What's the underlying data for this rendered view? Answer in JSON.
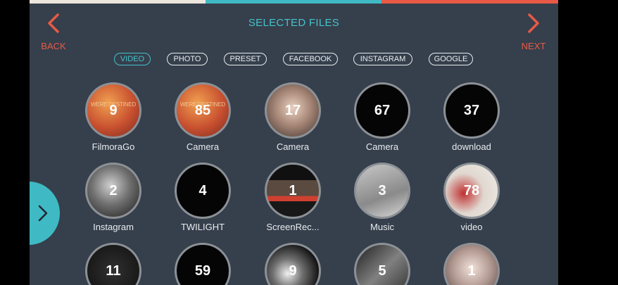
{
  "header": {
    "title": "SELECTED FILES",
    "back_label": "BACK",
    "next_label": "NEXT"
  },
  "filters": [
    {
      "label": "VIDEO",
      "active": true
    },
    {
      "label": "PHOTO",
      "active": false
    },
    {
      "label": "PRESET",
      "active": false
    },
    {
      "label": "FACEBOOK",
      "active": false
    },
    {
      "label": "INSTAGRAM",
      "active": false
    },
    {
      "label": "GOOGLE",
      "active": false
    }
  ],
  "folders": [
    {
      "name": "FilmoraGo",
      "count": "9",
      "overlay": "WERE DESTINED LY"
    },
    {
      "name": "Camera",
      "count": "85",
      "overlay": "WERE DESTINED LY"
    },
    {
      "name": "Camera",
      "count": "17"
    },
    {
      "name": "Camera",
      "count": "67"
    },
    {
      "name": "download",
      "count": "37"
    },
    {
      "name": "Instagram",
      "count": "2"
    },
    {
      "name": "TWILIGHT",
      "count": "4"
    },
    {
      "name": "ScreenRec...",
      "count": "1"
    },
    {
      "name": "Music",
      "count": "3"
    },
    {
      "name": "video",
      "count": "78"
    },
    {
      "name": "",
      "count": "11"
    },
    {
      "name": "",
      "count": "59"
    },
    {
      "name": "",
      "count": "9"
    },
    {
      "name": "",
      "count": "5"
    },
    {
      "name": "",
      "count": "1"
    }
  ],
  "colors": {
    "background": "#363f4c",
    "accent_teal": "#44c3cc",
    "accent_red": "#e85a45",
    "progress": [
      "#ece6dc",
      "#3fbac4",
      "#e85a45"
    ]
  },
  "icons": {
    "back": "chevron-left-icon",
    "next": "chevron-right-icon",
    "drawer": "chevron-right-icon"
  }
}
